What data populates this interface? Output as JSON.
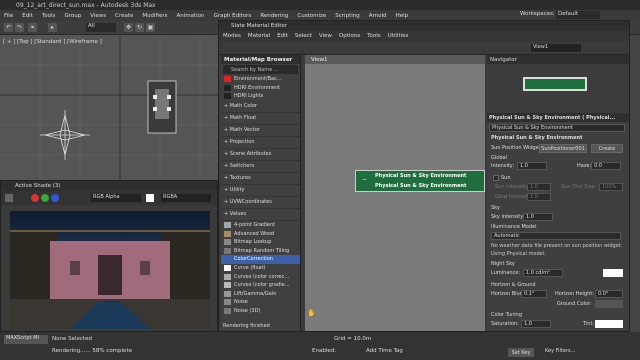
{
  "app": {
    "title": "09_12_art_direct_sun.max - Autodesk 3ds Max",
    "workspaces_label": "Workspaces:",
    "workspace_value": "Default"
  },
  "menubar": [
    "File",
    "Edit",
    "Tools",
    "Group",
    "Views",
    "Create",
    "Modifiers",
    "Animation",
    "Graph Editors",
    "Rendering",
    "Customize",
    "Scripting",
    "Arnold",
    "Help"
  ],
  "toolbar": {
    "selection_filter": "All"
  },
  "viewport": {
    "label": "[ + ] [Top ] [Standard ] [Wireframe ]"
  },
  "render_window": {
    "title": "Active Shade (3)",
    "channel": "RGB Alpha",
    "display": "RGBA"
  },
  "sme": {
    "title": "Slate Material Editor",
    "menu": [
      "Modes",
      "Material",
      "Edit",
      "Select",
      "View",
      "Options",
      "Tools",
      "Utilities"
    ],
    "view_tab": "View1",
    "view_label": "View1",
    "browser": {
      "title": "Material/Map Browser",
      "search_placeholder": "Search by Name ...",
      "top_items": [
        {
          "label": "Environment/Bac...",
          "color": "#d22"
        },
        {
          "label": "HDRI Environment",
          "color": "#222"
        },
        {
          "label": "HDRI Lights",
          "color": "#222"
        }
      ],
      "categories": [
        "+ Math Color",
        "+ Math Float",
        "+ Math Vector",
        "+ Projection",
        "+ Scene Attributes",
        "+ Switchers",
        "+ Textures",
        "+ Utility",
        "+ UVWCoordinates",
        "+ Values"
      ],
      "maps": [
        {
          "label": "4-point Gradient",
          "color": "#9aa"
        },
        {
          "label": "Advanced Wood",
          "color": "#a86"
        },
        {
          "label": "Bitmap Lookup",
          "color": "#888"
        },
        {
          "label": "Bitmap Random Tiling",
          "color": "#777"
        },
        {
          "label": "ColorCorrection",
          "color": "#3b5fa8",
          "selected": true
        },
        {
          "label": "Curve (float)",
          "color": "#fff"
        },
        {
          "label": "Curves (color correc...",
          "color": "#aaa"
        },
        {
          "label": "Curves (color gradie...",
          "color": "#bbb"
        },
        {
          "label": "Lift/Gamma/Gain",
          "color": "#999"
        },
        {
          "label": "Noise",
          "color": "#888"
        },
        {
          "label": "Noise (3D)",
          "color": "#777"
        }
      ]
    },
    "node": {
      "title": "Physical Sun & Sky Environment",
      "subtitle": "Physical Sun & Sky Environment"
    },
    "navigator": {
      "title": "Navigator"
    },
    "params": {
      "title": "Physical Sun & Sky Environment ( Physical...",
      "name": "Physical Sun & Sky Environment",
      "rollout": "Physical Sun & Sky Environment",
      "sun_widget_label": "Sun Position Widget:",
      "sun_widget_value": "SunPositioner001",
      "create_btn": "Create",
      "global": "Global",
      "intensity_label": "Intensity:",
      "intensity_value": "1.0",
      "haze_label": "Haze:",
      "haze_value": "0.0",
      "sun": "Sun",
      "sun_intensity": "Sun Intensity:",
      "sun_intensity_value": "1.0",
      "sun_disc_size": "Sun Disc Size:",
      "sun_disc_size_value": "100%",
      "glow_intensity": "Glow Intensity:",
      "glow_intensity_value": "1.0",
      "sky": "Sky",
      "sky_intensity_label": "Sky Intensity:",
      "sky_intensity_value": "1.0",
      "illum_model": "Illuminance Model",
      "illum_value": "Automatic",
      "note1": "No weather data file present on sun position widget.",
      "note2": "Using Physical model.",
      "night_sky": "Night Sky",
      "luminance_label": "Luminance:",
      "luminance_value": "1.0 cd/m²",
      "horizon_ground": "Horizon & Ground",
      "horizon_blur_label": "Horizon Blur:",
      "horizon_blur_value": "0.1°",
      "horizon_height_label": "Horizon Height:",
      "horizon_height_value": "0.0°",
      "ground_color_label": "Ground Color:",
      "color_tuning": "Color Tuning",
      "saturation_label": "Saturation:",
      "saturation_value": "1.0",
      "tint_label": "Tint:"
    },
    "status": "Rendering finished"
  },
  "status": {
    "none_selected": "None Selected",
    "rendering": "Rendering...... 58% complete",
    "maxscript": "MAXScript Mi",
    "grid": "Grid = 10.0m",
    "add_time_tag": "Add Time Tag",
    "enabled": "Enabled:",
    "set_key": "Set Key",
    "key_filters": "Key Filters..."
  },
  "colors": {
    "node_green": "#1f6e3d",
    "accent_blue": "#3b5fa8"
  }
}
